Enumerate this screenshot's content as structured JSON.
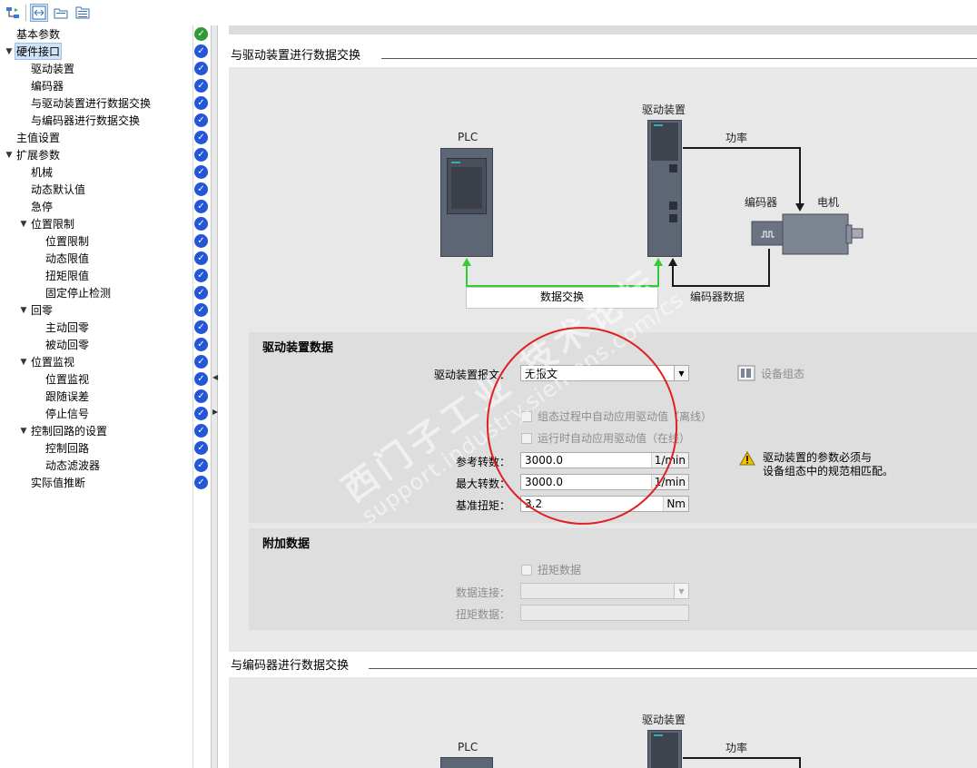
{
  "toolbar": {
    "icons": [
      "network-icon",
      "split-view-icon",
      "folder-icon",
      "folder-list-icon"
    ]
  },
  "nav": {
    "items": [
      {
        "label": "基本参数",
        "indent": 0,
        "tri": "",
        "status": "green"
      },
      {
        "label": "硬件接口",
        "indent": 0,
        "tri": "▼",
        "status": "blue",
        "selected": true
      },
      {
        "label": "驱动装置",
        "indent": 1,
        "tri": "",
        "status": "blue"
      },
      {
        "label": "编码器",
        "indent": 1,
        "tri": "",
        "status": "blue"
      },
      {
        "label": "与驱动装置进行数据交换",
        "indent": 1,
        "tri": "",
        "status": "blue"
      },
      {
        "label": "与编码器进行数据交换",
        "indent": 1,
        "tri": "",
        "status": "blue"
      },
      {
        "label": "主值设置",
        "indent": 0,
        "tri": "",
        "status": "blue"
      },
      {
        "label": "扩展参数",
        "indent": 0,
        "tri": "▼",
        "status": "blue"
      },
      {
        "label": "机械",
        "indent": 1,
        "tri": "",
        "status": "blue"
      },
      {
        "label": "动态默认值",
        "indent": 1,
        "tri": "",
        "status": "blue"
      },
      {
        "label": "急停",
        "indent": 1,
        "tri": "",
        "status": "blue"
      },
      {
        "label": "位置限制",
        "indent": 1,
        "tri": "▼",
        "status": "blue"
      },
      {
        "label": "位置限制",
        "indent": 2,
        "tri": "",
        "status": "blue"
      },
      {
        "label": "动态限值",
        "indent": 2,
        "tri": "",
        "status": "blue"
      },
      {
        "label": "扭矩限值",
        "indent": 2,
        "tri": "",
        "status": "blue"
      },
      {
        "label": "固定停止检测",
        "indent": 2,
        "tri": "",
        "status": "blue"
      },
      {
        "label": "回零",
        "indent": 1,
        "tri": "▼",
        "status": "blue"
      },
      {
        "label": "主动回零",
        "indent": 2,
        "tri": "",
        "status": "blue"
      },
      {
        "label": "被动回零",
        "indent": 2,
        "tri": "",
        "status": "blue"
      },
      {
        "label": "位置监视",
        "indent": 1,
        "tri": "▼",
        "status": "blue"
      },
      {
        "label": "位置监视",
        "indent": 2,
        "tri": "",
        "status": "blue"
      },
      {
        "label": "跟随误差",
        "indent": 2,
        "tri": "",
        "status": "blue"
      },
      {
        "label": "停止信号",
        "indent": 2,
        "tri": "",
        "status": "blue"
      },
      {
        "label": "控制回路的设置",
        "indent": 1,
        "tri": "▼",
        "status": "blue"
      },
      {
        "label": "控制回路",
        "indent": 2,
        "tri": "",
        "status": "blue"
      },
      {
        "label": "动态滤波器",
        "indent": 2,
        "tri": "",
        "status": "blue"
      },
      {
        "label": "实际值推断",
        "indent": 1,
        "tri": "",
        "status": "blue"
      }
    ]
  },
  "section1": {
    "title": "与驱动装置进行数据交换",
    "diagram": {
      "plc_label": "PLC",
      "drive_label": "驱动装置",
      "power_label": "功率",
      "encoder_label": "编码器",
      "motor_label": "电机",
      "exchange_label": "数据交换",
      "encoder_data_label": "编码器数据"
    },
    "drive_data": {
      "title": "驱动装置数据",
      "telegram_label": "驱动装置报文：",
      "telegram_value": "无报文",
      "device_config_label": "设备组态",
      "auto_apply_offline": "组态过程中自动应用驱动值（离线）",
      "auto_apply_online": "运行时自动应用驱动值（在线）",
      "ref_speed_label": "参考转数：",
      "ref_speed_value": "3000.0",
      "ref_speed_unit": "1/min",
      "max_speed_label": "最大转数：",
      "max_speed_value": "3000.0",
      "max_speed_unit": "1/min",
      "ref_torque_label": "基准扭矩：",
      "ref_torque_value": "3.2",
      "ref_torque_unit": "Nm",
      "warning_line1": "驱动装置的参数必须与",
      "warning_line2": "设备组态中的规范相匹配。"
    },
    "additional_data": {
      "title": "附加数据",
      "torque_data_checkbox": "扭矩数据",
      "data_connection_label": "数据连接：",
      "torque_data_label": "扭矩数据："
    }
  },
  "section2": {
    "title": "与编码器进行数据交换",
    "diagram": {
      "plc_label": "PLC",
      "drive_label": "驱动装置",
      "power_label": "功率"
    }
  },
  "watermark": {
    "line1": "西门子工业 技术论坛",
    "line2": "support.industry.siemens.com/cs"
  },
  "colors": {
    "green_status": "#2f9a3a",
    "blue_status": "#2457d6",
    "exchange_arrow": "#33cc33",
    "highlight_ellipse": "#e02020"
  }
}
